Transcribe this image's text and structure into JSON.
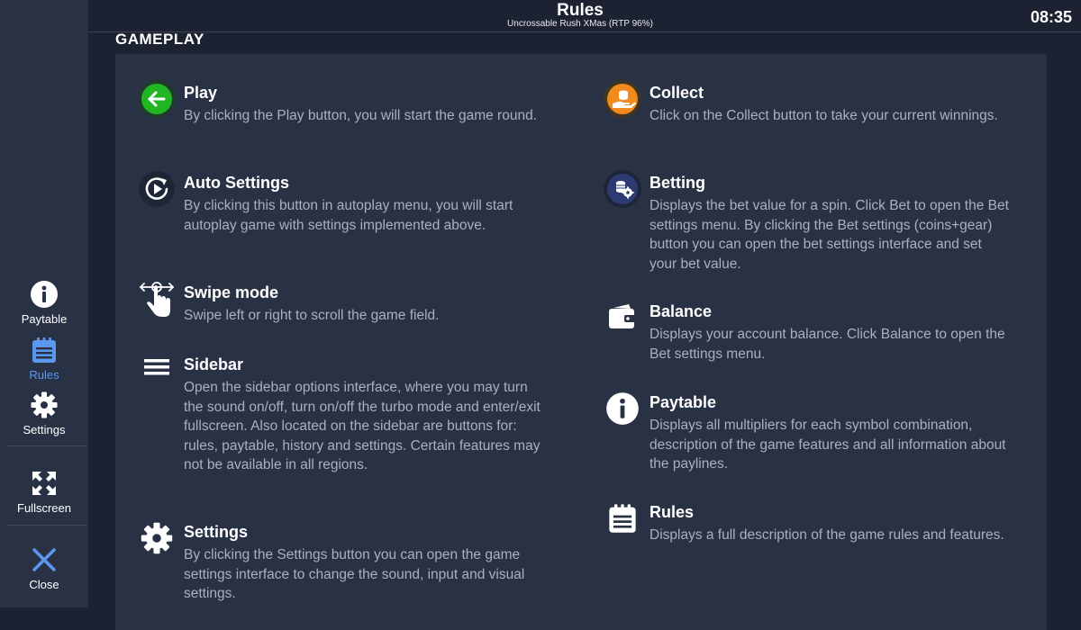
{
  "header": {
    "title": "Rules",
    "subtitle": "Uncrossable Rush XMas (RTP 96%)",
    "clock": "08:35"
  },
  "sidebar": {
    "paytable": "Paytable",
    "rules": "Rules",
    "settings": "Settings",
    "fullscreen": "Fullscreen",
    "close": "Close"
  },
  "section": {
    "title": "GAMEPLAY"
  },
  "colors": {
    "accent": "#5c97ef",
    "play_green": "#22b523",
    "collect_orange": "#f08a1c"
  },
  "left_items": [
    {
      "icon": "play-arrow-icon",
      "title": "Play",
      "desc": "By clicking the Play button, you will start the game round."
    },
    {
      "icon": "autoplay-icon",
      "title": "Auto Settings",
      "desc": "By clicking this button in autoplay menu, you will start autoplay game with settings implemented above."
    },
    {
      "icon": "swipe-hand-icon",
      "title": "Swipe mode",
      "desc": "Swipe left or right to scroll the game field."
    },
    {
      "icon": "hamburger-menu-icon",
      "title": "Sidebar",
      "desc": "Open the sidebar options interface, where you may turn the sound on/off, turn on/off the turbo mode and enter/exit fullscreen. Also located on the sidebar are buttons for: rules, paytable, history and settings. Certain features may not be available in all regions."
    },
    {
      "icon": "gear-icon",
      "title": "Settings",
      "desc": "By clicking the Settings button you can open the game settings interface to change the sound, input and visual settings."
    }
  ],
  "right_items": [
    {
      "icon": "collect-coins-icon",
      "title": "Collect",
      "desc": "Click on the Collect button to take your current winnings."
    },
    {
      "icon": "coins-gear-icon",
      "title": "Betting",
      "desc": "Displays the bet value for a spin. Click Bet to open the Bet settings menu. By clicking the Bet settings (coins+gear) button you can open the bet settings interface and set your bet value."
    },
    {
      "icon": "wallet-icon",
      "title": "Balance",
      "desc": "Displays your account balance. Click Balance to open the Bet settings menu."
    },
    {
      "icon": "info-icon",
      "title": "Paytable",
      "desc": "Displays all multipliers for each symbol combination, description of the game features and all information about the paylines."
    },
    {
      "icon": "notepad-icon",
      "title": "Rules",
      "desc": "Displays a full description of the game rules and features."
    }
  ]
}
